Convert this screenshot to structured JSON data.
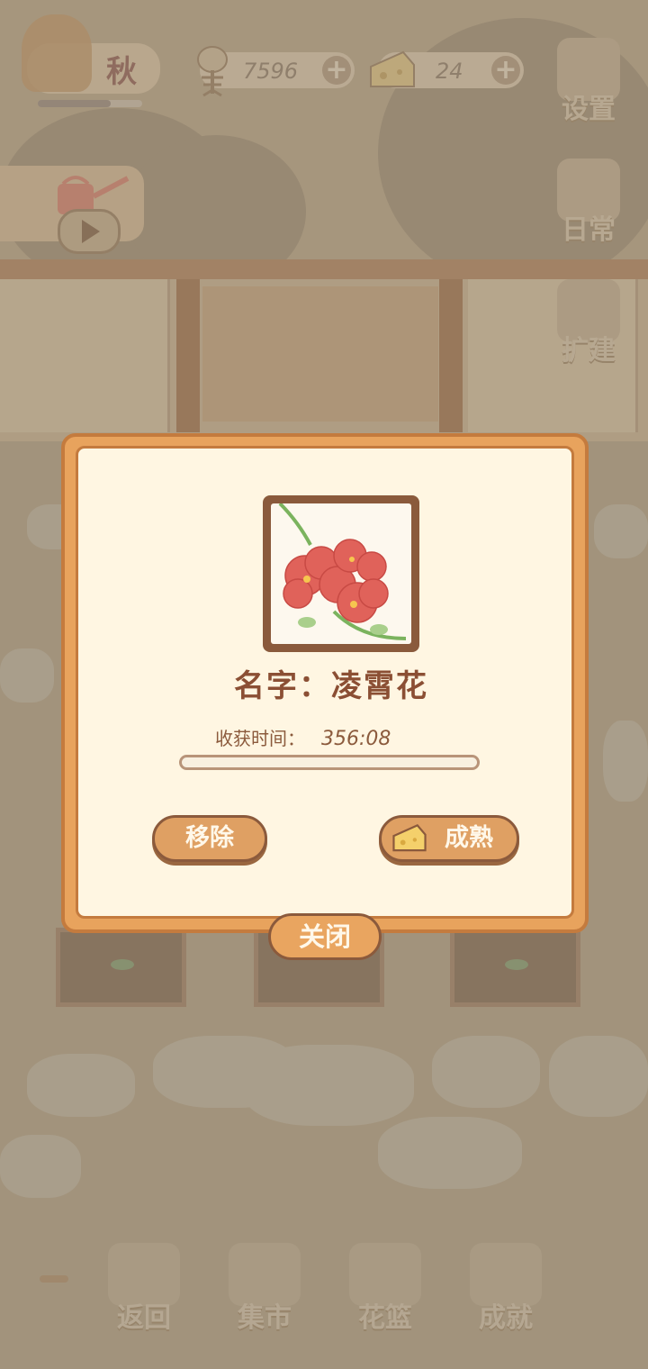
{
  "hud": {
    "season": "秋",
    "season_progress": 0.7,
    "fish_count": "7596",
    "cheese_count": "24",
    "plus": "+"
  },
  "side_menu": {
    "settings": "设置",
    "daily": "日常",
    "expand": "扩建"
  },
  "dialog": {
    "name_label": "名字：凌霄花",
    "harvest_time_label": "收获时间：",
    "harvest_time_value": "356:08",
    "progress": 0.0,
    "remove_button": "移除",
    "ripen_button": "成熟",
    "close_button": "关闭"
  },
  "bottom_nav": {
    "back": "返回",
    "market": "集市",
    "basket": "花篮",
    "achievements": "成就"
  },
  "colors": {
    "dialog_border": "#e8a35d",
    "dialog_bg": "#fff6e2",
    "title_text": "#8b4f34",
    "flower_red": "#e0625a"
  }
}
